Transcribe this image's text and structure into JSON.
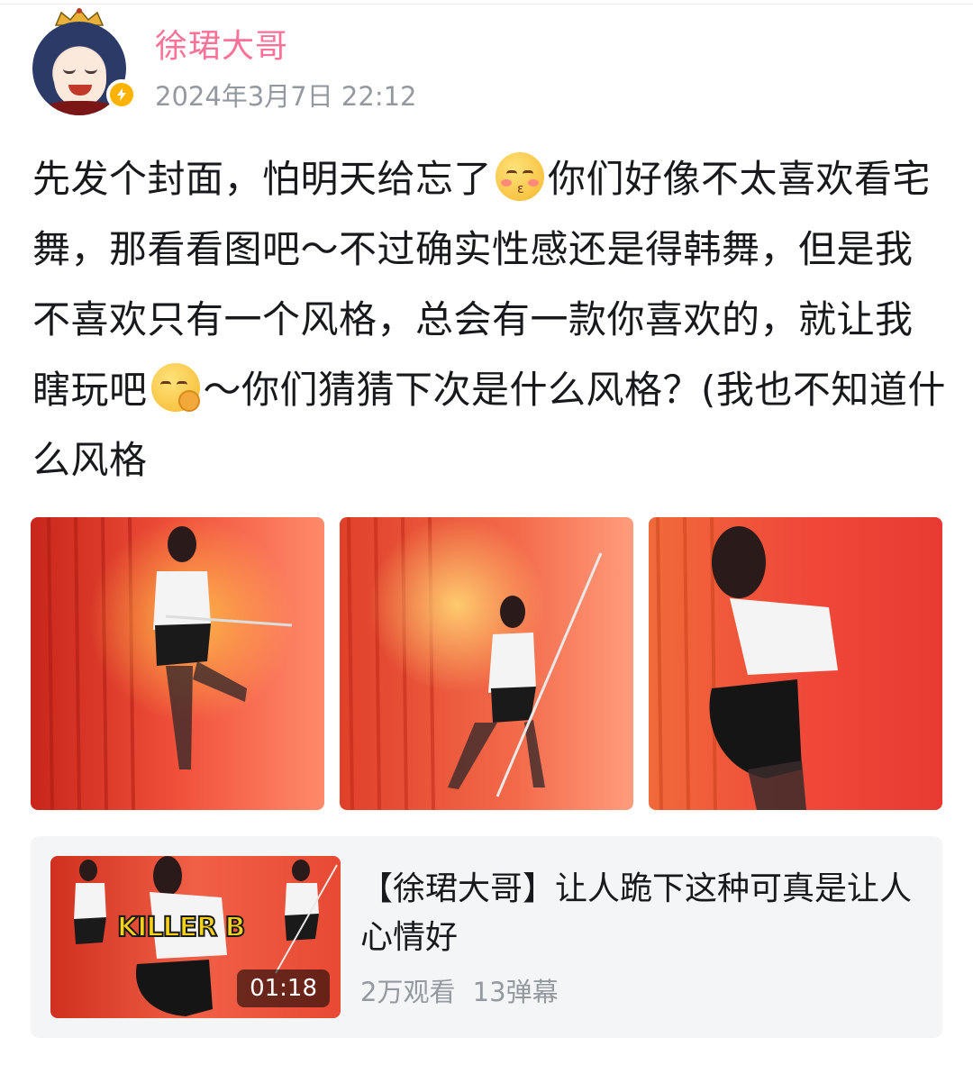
{
  "post": {
    "author": "徐珺大哥",
    "timestamp": "2024年3月7日 22:12",
    "text_parts": {
      "p1": "先发个封面，怕明天给忘了",
      "p2": "你们好像不太喜欢看宅舞，那看看图吧～不过确实性感还是得韩舞，但是我不喜欢只有一个风格，总会有一款你喜欢的，就让我瞎玩吧",
      "p3": "～你们猜猜下次是什么风格？(我也不知道什么风格"
    },
    "photos": [
      {
        "alt": "photo-1"
      },
      {
        "alt": "photo-2"
      },
      {
        "alt": "photo-3"
      }
    ]
  },
  "video_card": {
    "title": "【徐珺大哥】让人跪下这种可真是让人心情好",
    "thumbnail_text": "KILLER B",
    "duration": "01:18",
    "views": "2万观看",
    "danmaku": "13弹幕"
  },
  "colors": {
    "username": "#fb7299",
    "secondary_text": "#9499a0",
    "card_bg": "#f4f5f7",
    "badge": "#ffb300"
  },
  "icons": {
    "emoji_1": "kiss-emoji-icon",
    "emoji_2": "ok-hand-emoji-icon",
    "badge": "lightning-badge-icon"
  }
}
